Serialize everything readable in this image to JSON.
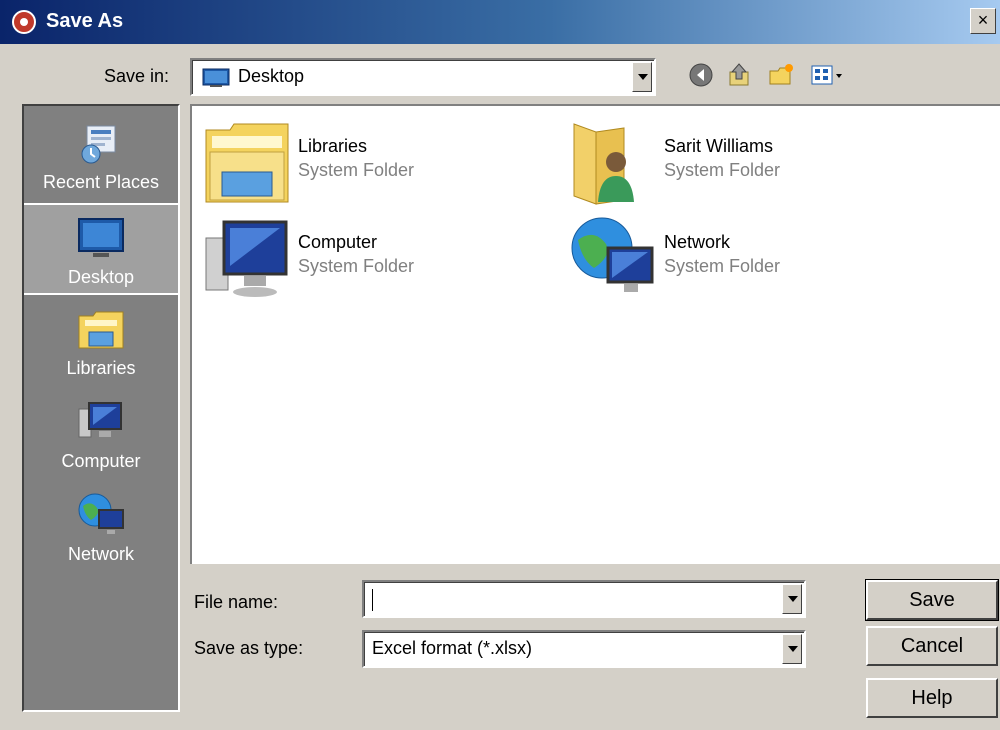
{
  "window": {
    "title": "Save As",
    "close_label": "×"
  },
  "toolbar": {
    "save_in_label": "Save in:",
    "location": "Desktop",
    "icons": [
      "back-icon",
      "up-folder-icon",
      "new-folder-icon",
      "view-menu-icon"
    ]
  },
  "places": [
    {
      "label": "Recent Places",
      "icon": "recent-places-icon",
      "selected": false
    },
    {
      "label": "Desktop",
      "icon": "desktop-icon",
      "selected": true
    },
    {
      "label": "Libraries",
      "icon": "libraries-icon",
      "selected": false
    },
    {
      "label": "Computer",
      "icon": "computer-icon",
      "selected": false
    },
    {
      "label": "Network",
      "icon": "network-icon",
      "selected": false
    }
  ],
  "files": [
    {
      "name": "Libraries",
      "type": "System Folder",
      "icon": "libraries-folder-icon"
    },
    {
      "name": "Sarit Williams",
      "type": "System Folder",
      "icon": "user-folder-icon"
    },
    {
      "name": "Computer",
      "type": "System Folder",
      "icon": "computer-icon"
    },
    {
      "name": "Network",
      "type": "System Folder",
      "icon": "network-icon"
    }
  ],
  "form": {
    "file_name_label": "File name:",
    "file_name_value": "",
    "save_as_type_label": "Save as type:",
    "save_as_type_value": "Excel format (*.xlsx)"
  },
  "buttons": {
    "save": "Save",
    "cancel": "Cancel",
    "help": "Help"
  },
  "colors": {
    "title_start": "#0a246a",
    "title_end": "#a6caf0",
    "dialog_bg": "#d4d0c8",
    "places_bg": "#808080"
  }
}
